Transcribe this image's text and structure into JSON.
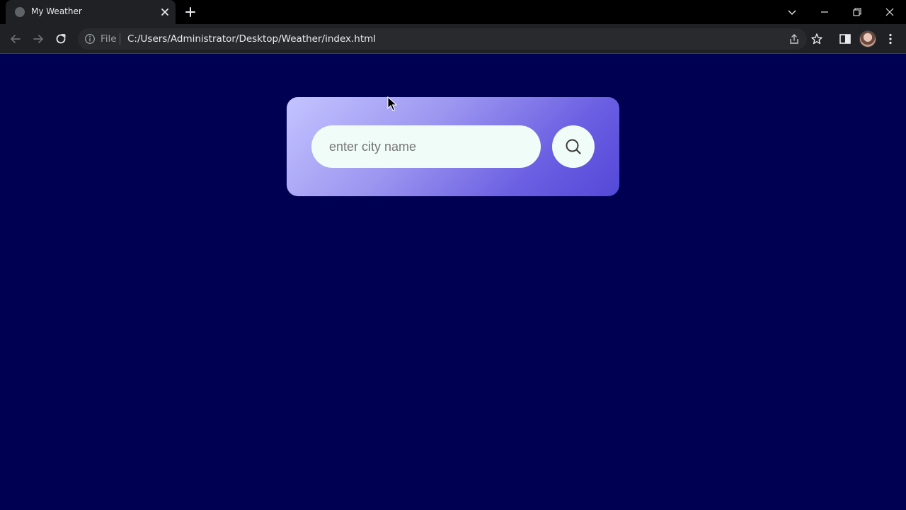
{
  "browser": {
    "tab_title": "My Weather",
    "url_scheme": "File",
    "url": "C:/Users/Administrator/Desktop/Weather/index.html"
  },
  "weather": {
    "search_placeholder": "enter city name",
    "search_value": ""
  },
  "icons": {
    "favicon": "globe-icon",
    "search": "search-icon"
  },
  "colors": {
    "page_background": "#000052",
    "card_gradient_start": "#c4c4ff",
    "card_gradient_end": "#5448d8",
    "input_background": "#f0fcf8"
  }
}
